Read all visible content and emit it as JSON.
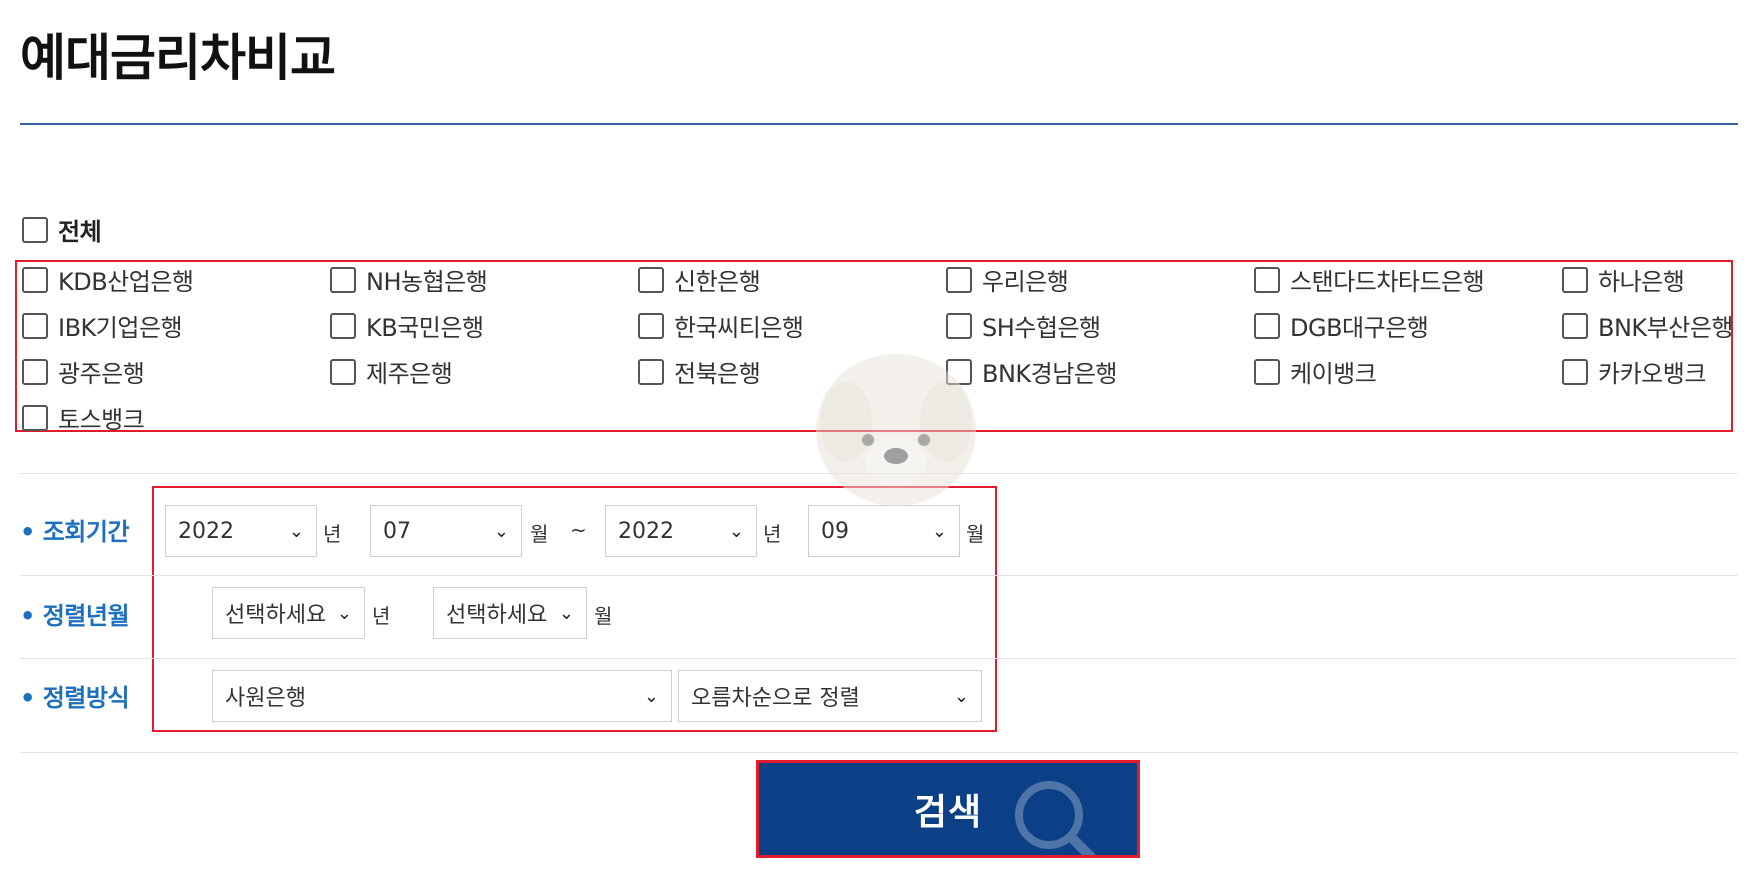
{
  "page": {
    "title": "예대금리차비교"
  },
  "select_all": {
    "label": "전체",
    "checked": false
  },
  "banks": [
    {
      "label": "KDB산업은행",
      "checked": false
    },
    {
      "label": "NH농협은행",
      "checked": false
    },
    {
      "label": "신한은행",
      "checked": false
    },
    {
      "label": "우리은행",
      "checked": false
    },
    {
      "label": "스탠다드차타드은행",
      "checked": false
    },
    {
      "label": "하나은행",
      "checked": false
    },
    {
      "label": "IBK기업은행",
      "checked": false
    },
    {
      "label": "KB국민은행",
      "checked": false
    },
    {
      "label": "한국씨티은행",
      "checked": false
    },
    {
      "label": "SH수협은행",
      "checked": false
    },
    {
      "label": "DGB대구은행",
      "checked": false
    },
    {
      "label": "BNK부산은행",
      "checked": false
    },
    {
      "label": "광주은행",
      "checked": false
    },
    {
      "label": "제주은행",
      "checked": false
    },
    {
      "label": "전북은행",
      "checked": false
    },
    {
      "label": "BNK경남은행",
      "checked": false
    },
    {
      "label": "케이뱅크",
      "checked": false
    },
    {
      "label": "카카오뱅크",
      "checked": false
    },
    {
      "label": "토스뱅크",
      "checked": false
    }
  ],
  "period": {
    "label": "조회기간",
    "start_year": "2022",
    "start_month": "07",
    "end_year": "2022",
    "end_month": "09",
    "year_unit": "년",
    "month_unit": "월",
    "separator": "~"
  },
  "sort_date": {
    "label": "정렬년월",
    "year_value": "선택하세요",
    "month_value": "선택하세요",
    "year_unit": "년",
    "month_unit": "월"
  },
  "sort_method": {
    "label": "정렬방식",
    "field_value": "사원은행",
    "order_value": "오름차순으로 정렬"
  },
  "search_button": {
    "label": "검색"
  },
  "colors": {
    "accent_blue": "#1d6fbf",
    "button_navy": "#0b3f86",
    "highlight_red": "#e31b2d",
    "title_rule": "#3d63a7"
  },
  "icons": [
    "search-icon",
    "chevron-down-icon",
    "checkbox-icon"
  ]
}
